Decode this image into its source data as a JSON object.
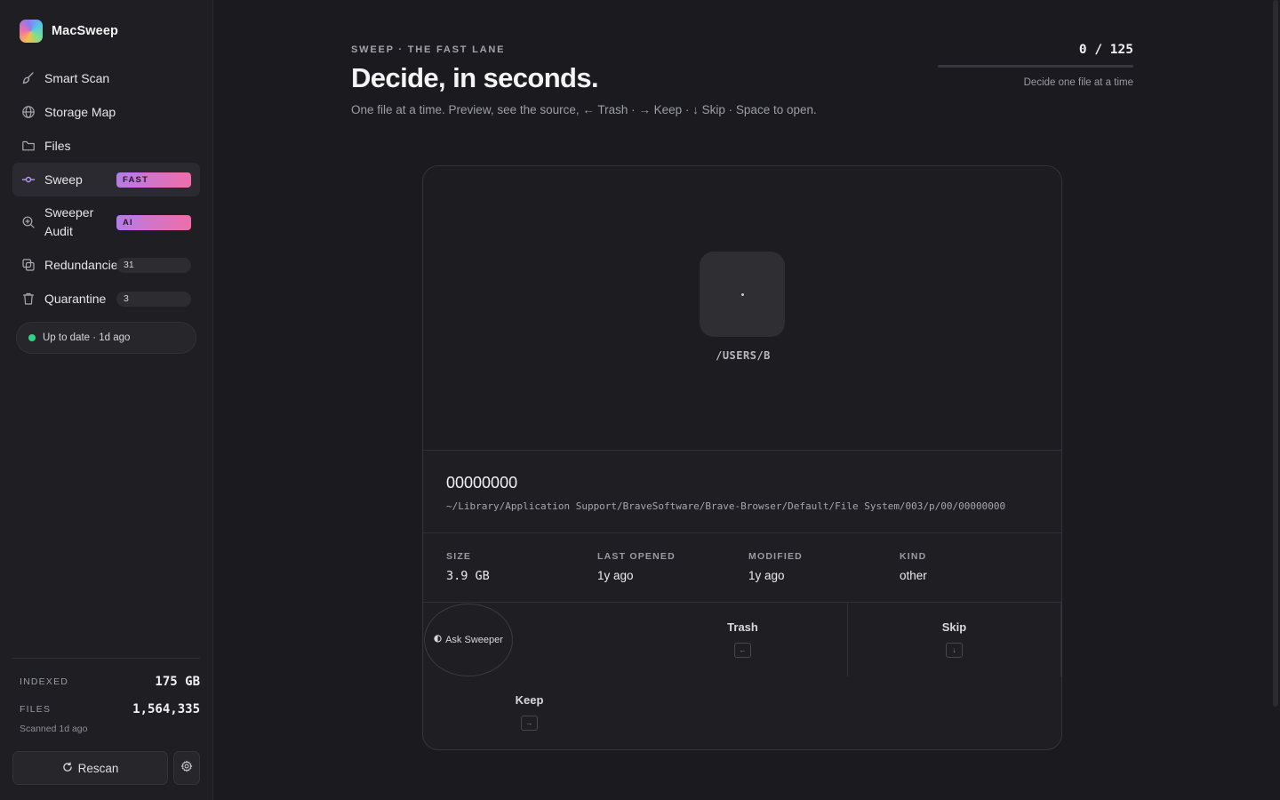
{
  "app": {
    "name": "MacSweep"
  },
  "sidebar": {
    "items": [
      {
        "label": "Smart Scan",
        "icon": "broom-icon"
      },
      {
        "label": "Storage Map",
        "icon": "globe-icon"
      },
      {
        "label": "Files",
        "icon": "folder-icon"
      },
      {
        "label": "Sweep",
        "icon": "sweep-icon",
        "badge": "FAST",
        "active": true
      },
      {
        "label": "Sweeper Audit",
        "icon": "audit-search-icon",
        "badge": "AI"
      },
      {
        "label": "Redundancies",
        "icon": "duplicate-icon",
        "count": "31"
      },
      {
        "label": "Quarantine",
        "icon": "trash-icon",
        "count": "3"
      }
    ],
    "status": "Up to date · 1d ago",
    "indexed_label": "INDEXED",
    "indexed_value": "175 GB",
    "files_label": "FILES",
    "files_value": "1,564,335",
    "scanned": "Scanned 1d ago",
    "rescan_label": "Rescan"
  },
  "header": {
    "eyebrow": "SWEEP · THE FAST LANE",
    "title": "Decide, in seconds.",
    "subtitle": "One file at a time. Preview, see the source, ← Trash · → Keep · ↓ Skip · Space to open."
  },
  "progress": {
    "count": "0 / 125",
    "current": 0,
    "total": 125,
    "hint": "Decide one file at a time",
    "fill_color": "#b57ce8"
  },
  "card": {
    "preview_label": "/USERS/B",
    "file_name": "00000000",
    "file_path": "~/Library/Application Support/BraveSoftware/Brave-Browser/Default/File System/003/p/00/00000000",
    "meta": {
      "size_label": "SIZE",
      "size_value": "3.9 GB",
      "opened_label": "LAST OPENED",
      "opened_value": "1y ago",
      "modified_label": "MODIFIED",
      "modified_value": "1y ago",
      "kind_label": "KIND",
      "kind_value": "other"
    },
    "actions": {
      "ask_label": "Ask Sweeper",
      "trash_label": "Trash",
      "trash_key": "←",
      "skip_label": "Skip",
      "skip_key": "↓",
      "keep_label": "Keep",
      "keep_key": "→"
    }
  },
  "colors": {
    "accent_gradient_start": "#b57ce8",
    "accent_gradient_end": "#ee6ea8",
    "status_green": "#35d088"
  }
}
